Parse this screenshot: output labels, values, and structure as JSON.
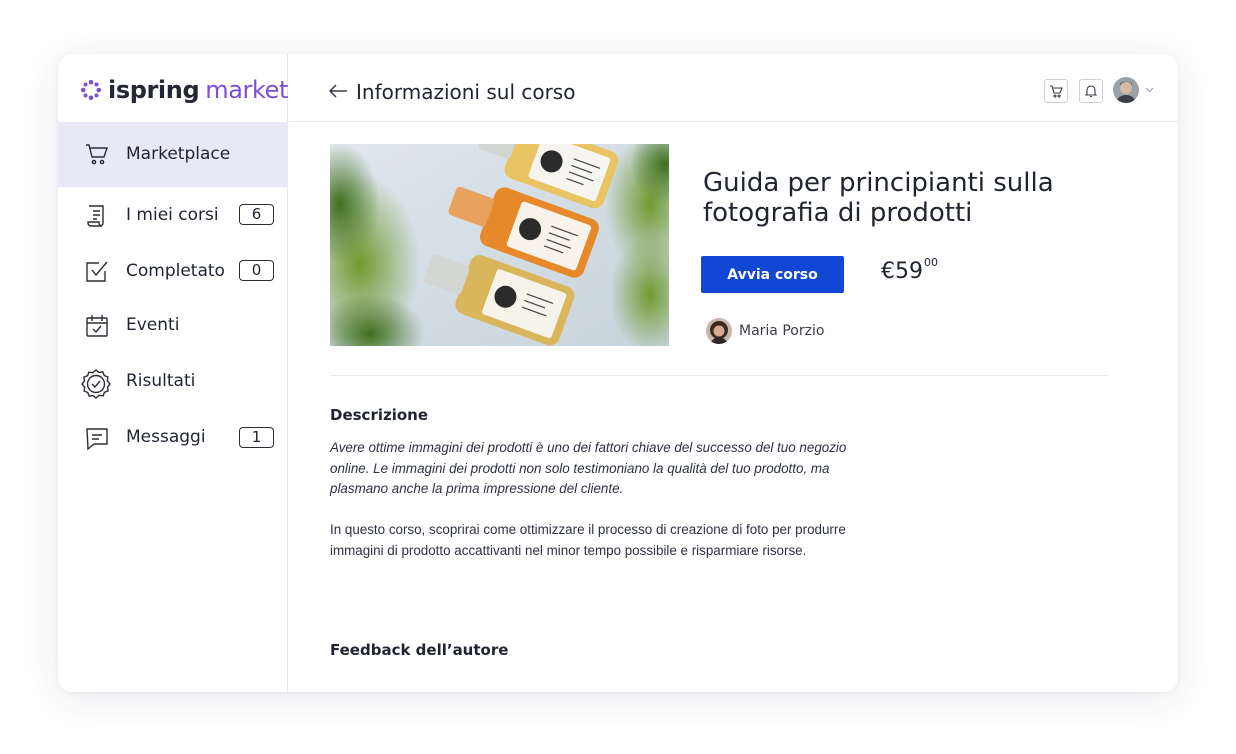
{
  "brand": {
    "name_part1": "ispring",
    "name_part2": "market"
  },
  "sidebar": {
    "items": [
      {
        "label": "Marketplace",
        "icon": "cart-icon",
        "active": true
      },
      {
        "label": "I miei corsi",
        "icon": "course-list-icon",
        "badge": "6"
      },
      {
        "label": "Completato",
        "icon": "check-box-icon",
        "badge": "0"
      },
      {
        "label": "Eventi",
        "icon": "calendar-icon"
      },
      {
        "label": "Risultati",
        "icon": "badge-check-icon"
      },
      {
        "label": "Messaggi",
        "icon": "message-icon",
        "badge": "1"
      }
    ]
  },
  "header": {
    "title": "Informazioni sul corso",
    "icons": [
      "back-arrow-icon",
      "cart-icon",
      "bell-icon",
      "avatar",
      "chevron-down-icon"
    ]
  },
  "course": {
    "title": "Guida per principianti sulla fotografia di prodotti",
    "start_label": "Avvia corso",
    "price_main": "€59",
    "price_cents": "00",
    "author": "Maria Porzio"
  },
  "description": {
    "title": "Descrizione",
    "para1": "Avere ottime immagini dei prodotti è uno dei fattori chiave del successo del tuo negozio online. Le immagini dei prodotti non solo testimoniano la qualità del tuo prodotto, ma plasmano anche la prima impressione del cliente.",
    "para2": "In questo corso, scoprirai come ottimizzare il processo di creazione di foto per produrre immagini di prodotto accattivanti nel minor tempo possibile e risparmiare risorse."
  },
  "feedback": {
    "title": "Feedback dell’autore"
  },
  "colors": {
    "accent": "#1247d6",
    "brand_purple": "#7b4fd8",
    "active_bg": "#e9e8f7"
  }
}
